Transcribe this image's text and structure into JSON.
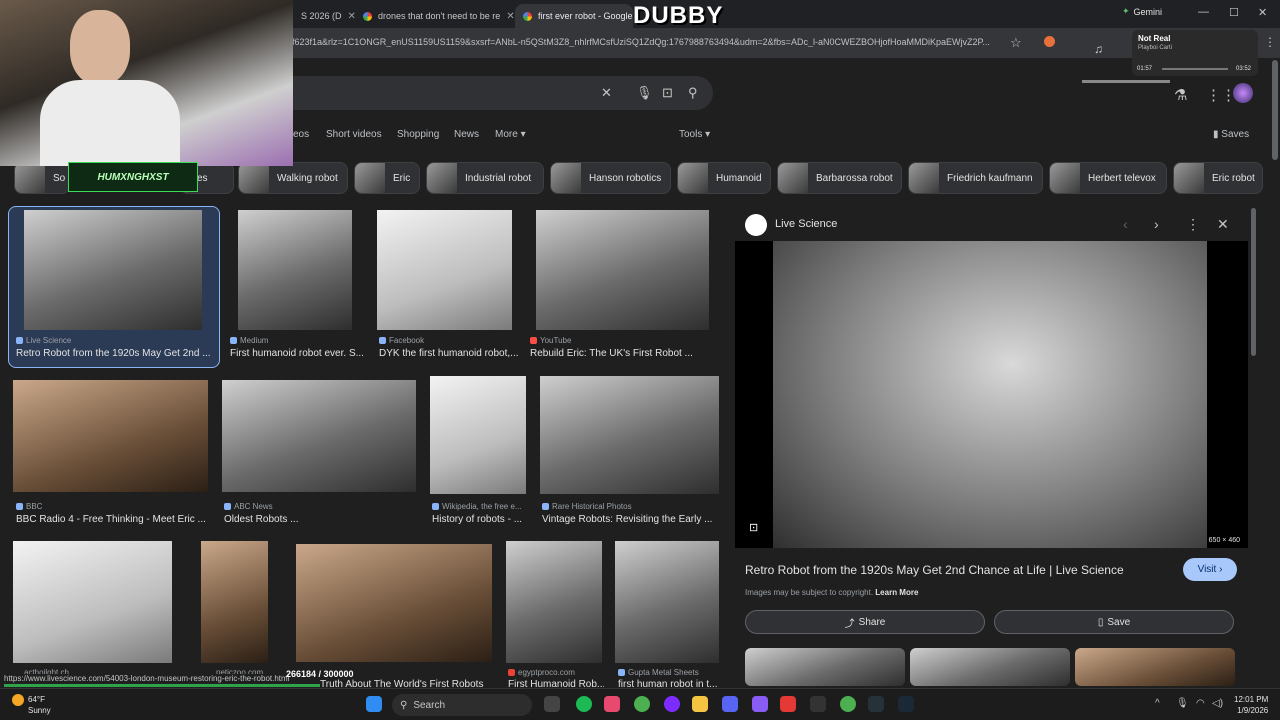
{
  "tabs": [
    {
      "label": "S 2026 (D"
    },
    {
      "label": "drones that don't need to be re"
    },
    {
      "label": "first ever robot - Google Se"
    }
  ],
  "gemini_label": "Gemini",
  "url": "f623f1a&rlz=1C1ONGR_enUS1159US1159&sxsrf=ANbL-n5QStM3Z8_nhlrfMCsfUziSQ1ZdQg:1767988763494&udm=2&fbs=ADc_l-aN0CWEZBOHjofHoaMMDiKpaEWjvZ2P...",
  "nav_tabs": {
    "videos": "eos",
    "short_videos": "Short videos",
    "shopping": "Shopping",
    "news": "News",
    "more": "More",
    "tools": "Tools",
    "saves": "Saves"
  },
  "chips": [
    {
      "label": "So"
    },
    {
      "label": "es"
    },
    {
      "label": "Walking robot"
    },
    {
      "label": "Eric"
    },
    {
      "label": "Industrial robot"
    },
    {
      "label": "Hanson robotics"
    },
    {
      "label": "Humanoid"
    },
    {
      "label": "Barbarossa robot"
    },
    {
      "label": "Friedrich kaufmann"
    },
    {
      "label": "Herbert televox"
    },
    {
      "label": "Eric robot"
    }
  ],
  "results": [
    {
      "source": "Live Science",
      "caption": "Retro Robot from the 1920s May Get 2nd ..."
    },
    {
      "source": "Medium",
      "caption": "First humanoid robot ever. S..."
    },
    {
      "source": "Facebook",
      "caption": "DYK the first humanoid robot,..."
    },
    {
      "source": "YouTube",
      "caption": "Rebuild Eric: The UK's First Robot ..."
    },
    {
      "source": "BBC",
      "caption": "BBC Radio 4 - Free Thinking - Meet Eric ..."
    },
    {
      "source": "ABC News",
      "caption": "Oldest Robots ..."
    },
    {
      "source": "Wikipedia, the free e...",
      "caption": "History of robots - ..."
    },
    {
      "source": "Rare Historical Photos",
      "caption": "Vintage Robots: Revisiting the Early ..."
    },
    {
      "source": "egyptproco.com",
      "caption": "First Humanoid Rob..."
    },
    {
      "source": "Gupta Metal Sheets",
      "caption": "first human robot in t..."
    }
  ],
  "row3_partial": {
    "caption_mid": "Truth About The World's First Robots",
    "src_a": "acthoilght.ch",
    "src_b": "peticzoo.com"
  },
  "panel": {
    "source": "Live Science",
    "title": "Retro Robot from the 1920s May Get 2nd Chance at Life | Live Science",
    "visit": "Visit",
    "copyright": "Images may be subject to copyright.",
    "learn_more": "Learn More",
    "share": "Share",
    "save": "Save",
    "dims": "650 × 460"
  },
  "overlay": {
    "brand": "DUBBY",
    "webcam_logo": "HUMXNGHXST",
    "song_title": "Not Real",
    "song_artist": "Playboi Carti",
    "time_elapsed": "01:57",
    "time_total": "03:52",
    "counter": "266184 / 300000"
  },
  "status_url": "https://www.livescience.com/54003-london-museum-restoring-eric-the-robot.html",
  "taskbar": {
    "temp": "64°F",
    "weather": "Sunny",
    "search": "Search",
    "time": "12:01 PM",
    "date": "1/9/2026"
  },
  "colors": {
    "accent": "#8ab4f8",
    "visit_bg": "#a8c7fa",
    "progress": "#2fa24a"
  },
  "icons": [
    "close-icon",
    "mic-icon",
    "lens-icon",
    "search-icon",
    "star-icon",
    "flask-icon",
    "apps-icon",
    "bookmark-icon",
    "chevron-left-icon",
    "chevron-right-icon",
    "more-vert-icon",
    "share-icon",
    "windows-icon"
  ]
}
